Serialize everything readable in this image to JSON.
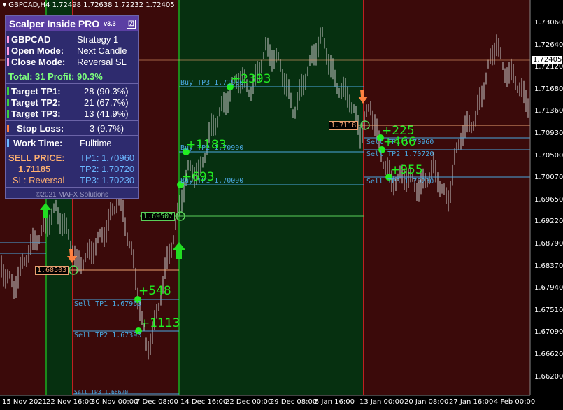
{
  "window": {
    "symbol_line": "GBPCAD,H4  1.72498 1.72638 1.72232 1.72405"
  },
  "colors": {
    "sell_zone": "#3b0a0a",
    "buy_zone": "#063010",
    "up_arrow": "#22dd22",
    "down_arrow": "#ff8040",
    "profit": "#22ee22",
    "tp_line": "#4aa8e0",
    "entry_line": "#e8a070"
  },
  "price_axis": {
    "ticks": [
      "1.73060",
      "1.72640",
      "1.72120",
      "1.71680",
      "1.71360",
      "1.70930",
      "1.70500",
      "1.70070",
      "1.69650",
      "1.69220",
      "1.68790",
      "1.68370",
      "1.67940",
      "1.67510",
      "1.67090",
      "1.66620",
      "1.66200"
    ],
    "current_price": "1.72405"
  },
  "time_axis": {
    "labels": [
      "15 Nov 2021",
      "22 Nov 16:00",
      "30 Nov 00:00",
      "7 Dec 08:00",
      "14 Dec 16:00",
      "22 Dec 00:00",
      "29 Dec 08:00",
      "5 Jan 16:00",
      "13 Jan 00:00",
      "20 Jan 08:00",
      "27 Jan 16:00",
      "4 Feb 00:00"
    ]
  },
  "panel": {
    "title": "Scalper Inside PRO",
    "version": "v3.3",
    "checkbox": "☑",
    "symbol": "GBPCAD",
    "strategy": "Strategy 1",
    "open_mode_label": "Open Mode:",
    "open_mode": "Next Candle",
    "close_mode_label": "Close Mode:",
    "close_mode": "Reversal SL",
    "total": "Total: 31  Profit: 90.3%",
    "tp1_label": "Target TP1:",
    "tp1_value": "28 (90.3%)",
    "tp2_label": "Target TP2:",
    "tp2_value": "21 (67.7%)",
    "tp3_label": "Target TP3:",
    "tp3_value": "13 (41.9%)",
    "sl_label": "Stop Loss:",
    "sl_value": "3 (9.7%)",
    "work_label": "Work Time:",
    "work_value": "Fulltime",
    "sell_price_label": "SELL PRICE:",
    "sell_price": "1.71185",
    "sl_mode": "SL: Reversal",
    "tp1": "TP1: 1.70960",
    "tp2": "TP2: 1.70720",
    "tp3": "TP3: 1.70230",
    "copyright": "©2021 MAFX Solutions"
  },
  "chart_labels": {
    "entry_a": "1.68503",
    "entry_b": "1.69507",
    "entry_c": "1.7118",
    "sell_tp1_a": "Sell TP1 1.67960",
    "sell_tp2_a": "Sell TP2 1.67390",
    "sell_tp3_a": "Sell TP3 1.66620",
    "buy_tp1": "Buy TP1 1.70090",
    "buy_tp2": "Buy TP2 1.70990",
    "buy_tp3": "Buy TP3 1.71900",
    "sell_tp1_c": "Sell TP1 1.70960",
    "sell_tp2_c": "Sell TP2 1.70720",
    "sell_tp3_c": "Sell TP3 1.70230",
    "p1": "+548",
    "p2": "+1113",
    "p3": "+693",
    "p4": "+1183",
    "p5": "+2393",
    "p6": "+225",
    "p7": "+466",
    "p8": "+955"
  }
}
